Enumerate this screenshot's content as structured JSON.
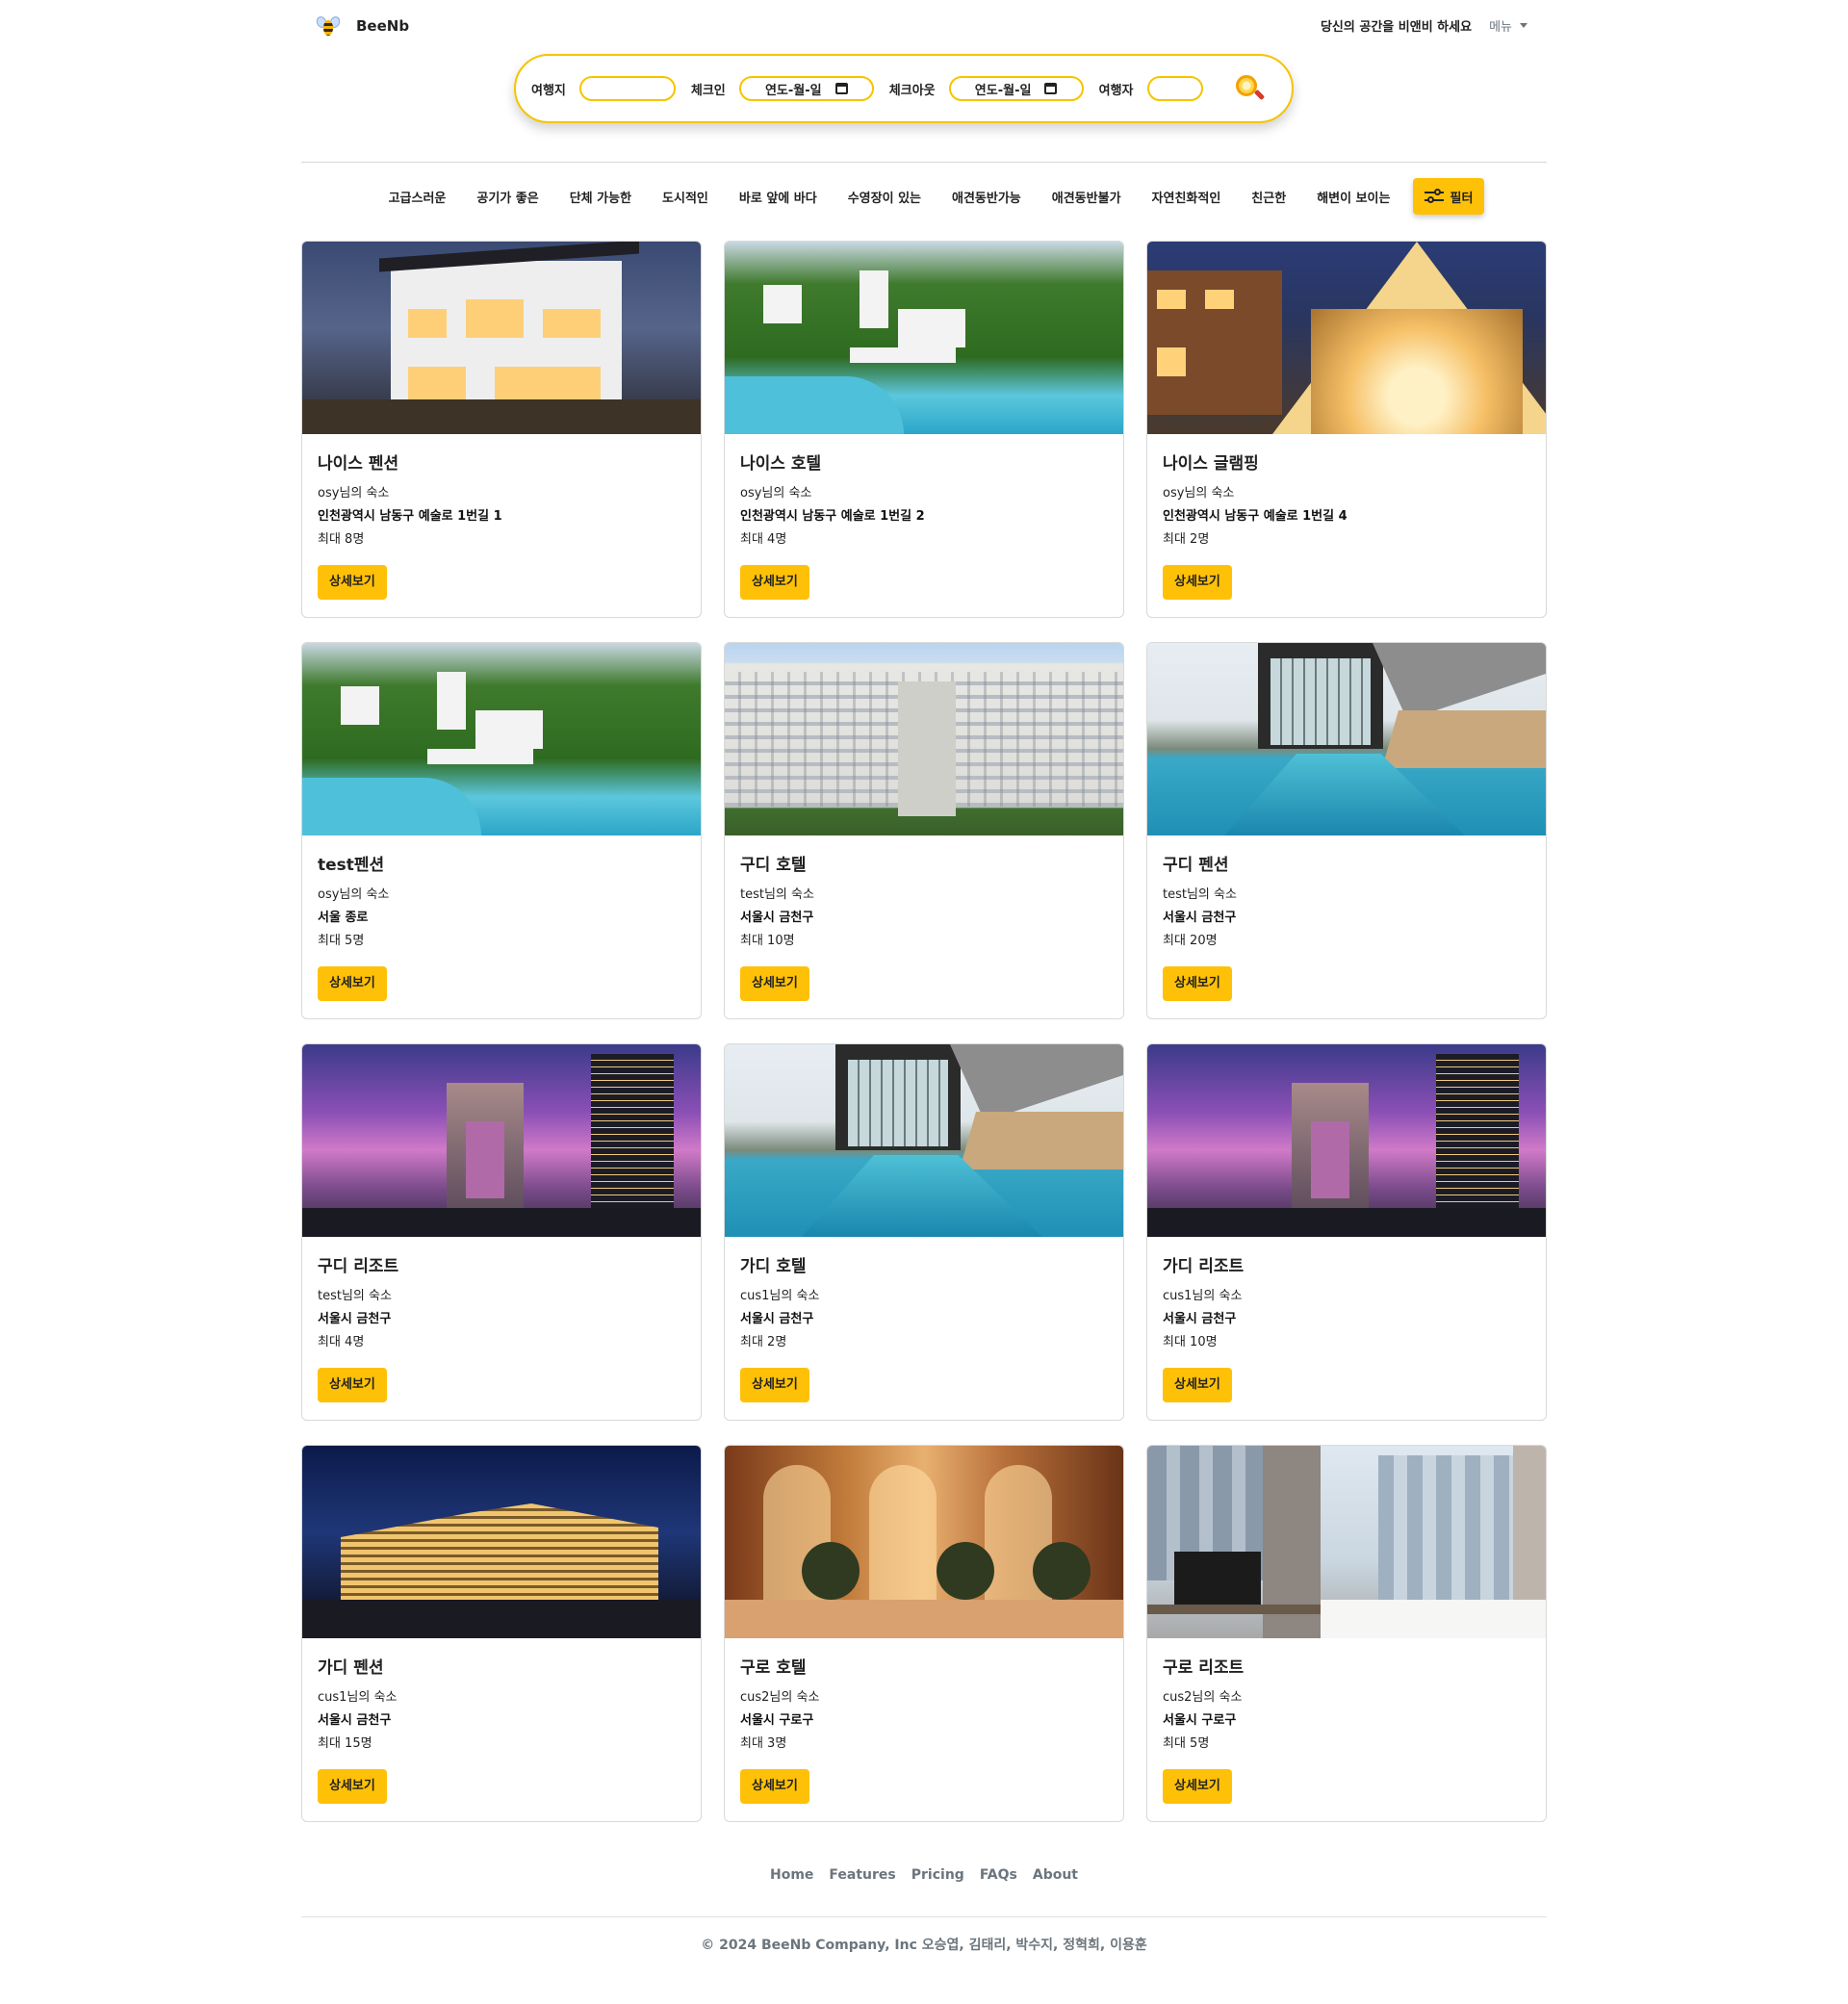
{
  "header": {
    "brand": "BeeNb",
    "host_link": "당신의 공간을 비앤비 하세요",
    "menu": "메뉴"
  },
  "search": {
    "destination_label": "여행지",
    "destination_value": "",
    "checkin_label": "체크인",
    "checkin_placeholder": "연도-월-일",
    "checkout_label": "체크아웃",
    "checkout_placeholder": "연도-월-일",
    "guests_label": "여행자",
    "guests_value": ""
  },
  "categories": [
    "고급스러운",
    "공기가 좋은",
    "단체 가능한",
    "도시적인",
    "바로 앞에 바다",
    "수영장이 있는",
    "애견동반가능",
    "애견동반불가",
    "자연친화적인",
    "친근한",
    "해변이 보이는"
  ],
  "filter_label": "필터",
  "detail_label": "상세보기",
  "listings": [
    {
      "title": "나이스 펜션",
      "host": "osy님의 숙소",
      "address": "인천광역시 남동구 예술로 1번길 1",
      "capacity": "최대 8명",
      "photo": "villa"
    },
    {
      "title": "나이스 호텔",
      "host": "osy님의 숙소",
      "address": "인천광역시 남동구 예술로 1번길 2",
      "capacity": "최대 4명",
      "photo": "resort"
    },
    {
      "title": "나이스 글램핑",
      "host": "osy님의 숙소",
      "address": "인천광역시 남동구 예술로 1번길 4",
      "capacity": "최대 2명",
      "photo": "glamping"
    },
    {
      "title": "test펜션",
      "host": "osy님의 숙소",
      "address": "서울 종로",
      "capacity": "최대 5명",
      "photo": "resort"
    },
    {
      "title": "구디 호텔",
      "host": "test님의 숙소",
      "address": "서울시 금천구",
      "capacity": "최대 10명",
      "photo": "facade"
    },
    {
      "title": "구디 펜션",
      "host": "test님의 숙소",
      "address": "서울시 금천구",
      "capacity": "최대 20명",
      "photo": "pool"
    },
    {
      "title": "구디 리조트",
      "host": "test님의 숙소",
      "address": "서울시 금천구",
      "capacity": "최대 4명",
      "photo": "twin-towers"
    },
    {
      "title": "가디 호텔",
      "host": "cus1님의 숙소",
      "address": "서울시 금천구",
      "capacity": "최대 2명",
      "photo": "pool"
    },
    {
      "title": "가디 리조트",
      "host": "cus1님의 숙소",
      "address": "서울시 금천구",
      "capacity": "최대 10명",
      "photo": "twin-towers"
    },
    {
      "title": "가디 펜션",
      "host": "cus1님의 숙소",
      "address": "서울시 금천구",
      "capacity": "최대 15명",
      "photo": "hilton"
    },
    {
      "title": "구로 호텔",
      "host": "cus2님의 숙소",
      "address": "서울시 구로구",
      "capacity": "최대 3명",
      "photo": "lobby"
    },
    {
      "title": "구로 리조트",
      "host": "cus2님의 숙소",
      "address": "서울시 구로구",
      "capacity": "최대 5명",
      "photo": "room"
    }
  ],
  "footer": {
    "links": [
      "Home",
      "Features",
      "Pricing",
      "FAQs",
      "About"
    ],
    "copyright": "© 2024 BeeNb Company, Inc 오승엽, 김태리, 박수지, 정혁희, 이용훈"
  },
  "colors": {
    "accent": "#ffc107",
    "search_border": "#f5c400"
  }
}
